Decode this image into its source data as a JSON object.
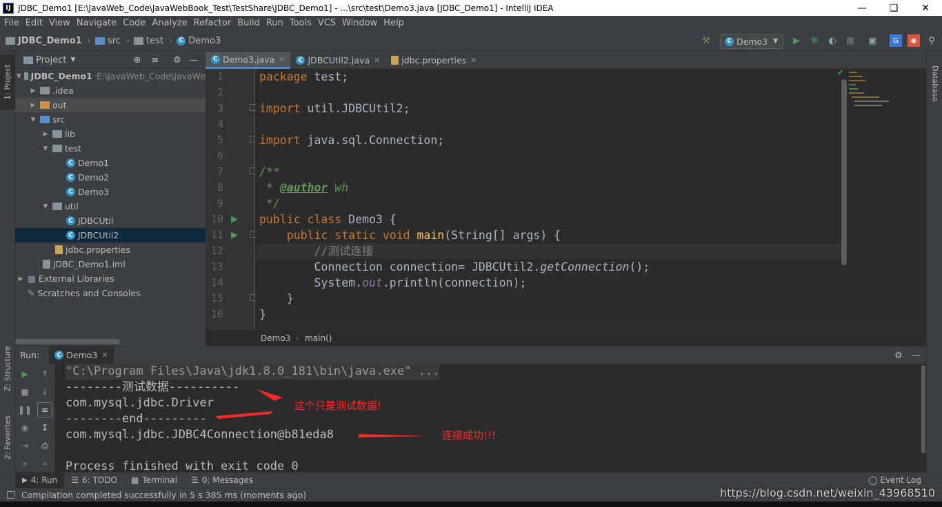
{
  "window": {
    "title": "JDBC_Demo1 [E:\\JavaWeb_Code\\JavaWebBook_Test\\TestShare\\JDBC_Demo1] - ...\\src\\test\\Demo3.java [JDBC_Demo1] - IntelliJ IDEA",
    "app_icon": "IJ"
  },
  "menu": [
    "File",
    "Edit",
    "View",
    "Navigate",
    "Code",
    "Analyze",
    "Refactor",
    "Build",
    "Run",
    "Tools",
    "VCS",
    "Window",
    "Help"
  ],
  "breadcrumbs": [
    "JDBC_Demo1",
    "src",
    "test",
    "Demo3"
  ],
  "run_config": "Demo3",
  "left_strip": {
    "project": "1: Project",
    "structure": "Z: Structure",
    "favorites": "2: Favorites"
  },
  "right_strip": {
    "database": "Database"
  },
  "project_panel": {
    "title": "Project",
    "tree": [
      {
        "label": "JDBC_Demo1",
        "hint": "E:\\JavaWeb_Code\\JavaWe"
      },
      {
        "label": ".idea"
      },
      {
        "label": "out"
      },
      {
        "label": "src"
      },
      {
        "label": "lib"
      },
      {
        "label": "test"
      },
      {
        "label": "Demo1"
      },
      {
        "label": "Demo2"
      },
      {
        "label": "Demo3"
      },
      {
        "label": "util"
      },
      {
        "label": "JDBCUtil"
      },
      {
        "label": "JDBCUtil2"
      },
      {
        "label": "jdbc.properties"
      },
      {
        "label": "JDBC_Demo1.iml"
      },
      {
        "label": "External Libraries"
      },
      {
        "label": "Scratches and Consoles"
      }
    ]
  },
  "editor_tabs": [
    "Demo3.java",
    "JDBCUtil2.java",
    "jdbc.properties"
  ],
  "code": {
    "line_numbers": [
      "1",
      "2",
      "3",
      "4",
      "5",
      "6",
      "7",
      "8",
      "9",
      "10",
      "11",
      "12",
      "13",
      "14",
      "15",
      "16"
    ],
    "l1_kw": "package",
    "l1_rest": " test;",
    "l3_kw": "import",
    "l3_rest": " util.JDBCUtil2;",
    "l5_kw": "import",
    "l5_rest": " java.sql.Connection;",
    "l7": "/**",
    "l8_star": " * ",
    "l8_tag": "@author",
    "l8_rest": " wh",
    "l9": " */",
    "l10_kw": "public class",
    "l10_rest": " Demo3 {",
    "l11_indent": "    ",
    "l11_kw": "public static void",
    "l11_fn": " main",
    "l11_rest": "(String[] args) {",
    "l12": "        //测试连接",
    "l13_a": "        Connection connection= JDBCUtil2.",
    "l13_b": "getConnection",
    "l13_c": "();",
    "l14_a": "        System.",
    "l14_b": "out",
    "l14_c": ".println(connection);",
    "l15": "    }",
    "l16": "}"
  },
  "editor_breadcrumb": [
    "Demo3",
    "main()"
  ],
  "run_panel": {
    "label": "Run:",
    "tab": "Demo3",
    "console": [
      "\"C:\\Program Files\\Java\\jdk1.8.0_181\\bin\\java.exe\" ...",
      "--------测试数据----------",
      "com.mysql.jdbc.Driver",
      "--------end---------",
      "com.mysql.jdbc.JDBC4Connection@b81eda8",
      "",
      "Process finished with exit code 0"
    ],
    "annotations": [
      "这个只是测试数据!",
      "连接成功!!!"
    ]
  },
  "bottom_tabs": [
    "4: Run",
    "6: TODO",
    "Terminal",
    "0: Messages"
  ],
  "event_log": "Event Log",
  "status": "Compilation completed successfully in 5 s 385 ms (moments ago)",
  "watermark": "https://blog.csdn.net/weixin_43968510"
}
